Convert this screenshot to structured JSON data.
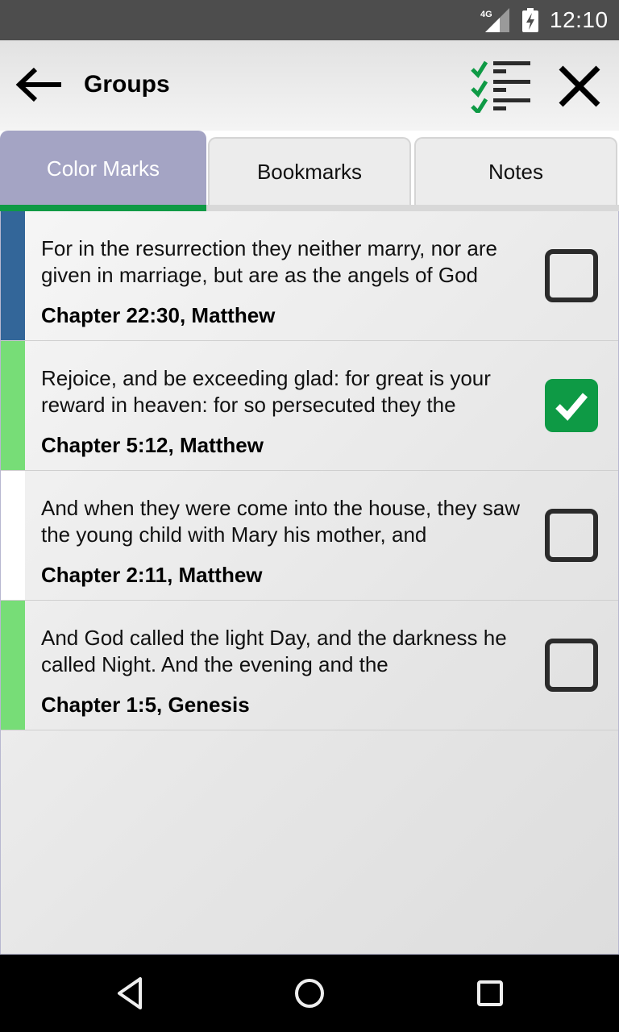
{
  "status_bar": {
    "network": "4G",
    "time": "12:10"
  },
  "app_bar": {
    "title": "Groups",
    "back_icon": "arrow-left-icon",
    "select_all_icon": "checklist-icon",
    "close_icon": "close-icon"
  },
  "tabs": [
    {
      "label": "Color Marks",
      "active": true
    },
    {
      "label": "Bookmarks",
      "active": false
    },
    {
      "label": "Notes",
      "active": false
    }
  ],
  "colors": {
    "accent_green": "#0e9a45",
    "active_tab": "#a4a4c4"
  },
  "items": [
    {
      "verse": "For in the resurrection they neither marry, nor are given in marriage, but are as the angels of God",
      "reference": "Chapter 22:30, Matthew",
      "mark_color": "#336699",
      "checked": false
    },
    {
      "verse": "Rejoice, and be exceeding glad: for great is your reward in heaven: for so persecuted they the",
      "reference": "Chapter 5:12, Matthew",
      "mark_color": "#77dd77",
      "checked": true
    },
    {
      "verse": "And when they were come into the house, they saw the young child with Mary his mother, and",
      "reference": "Chapter 2:11, Matthew",
      "mark_color": "#ffffff",
      "checked": false
    },
    {
      "verse": "And God called the light Day, and the darkness he called Night. And the evening and the",
      "reference": "Chapter 1:5, Genesis",
      "mark_color": "#77dd77",
      "checked": false
    }
  ],
  "nav_bar": {
    "back": "back-triangle-icon",
    "home": "home-circle-icon",
    "recents": "recents-square-icon"
  }
}
